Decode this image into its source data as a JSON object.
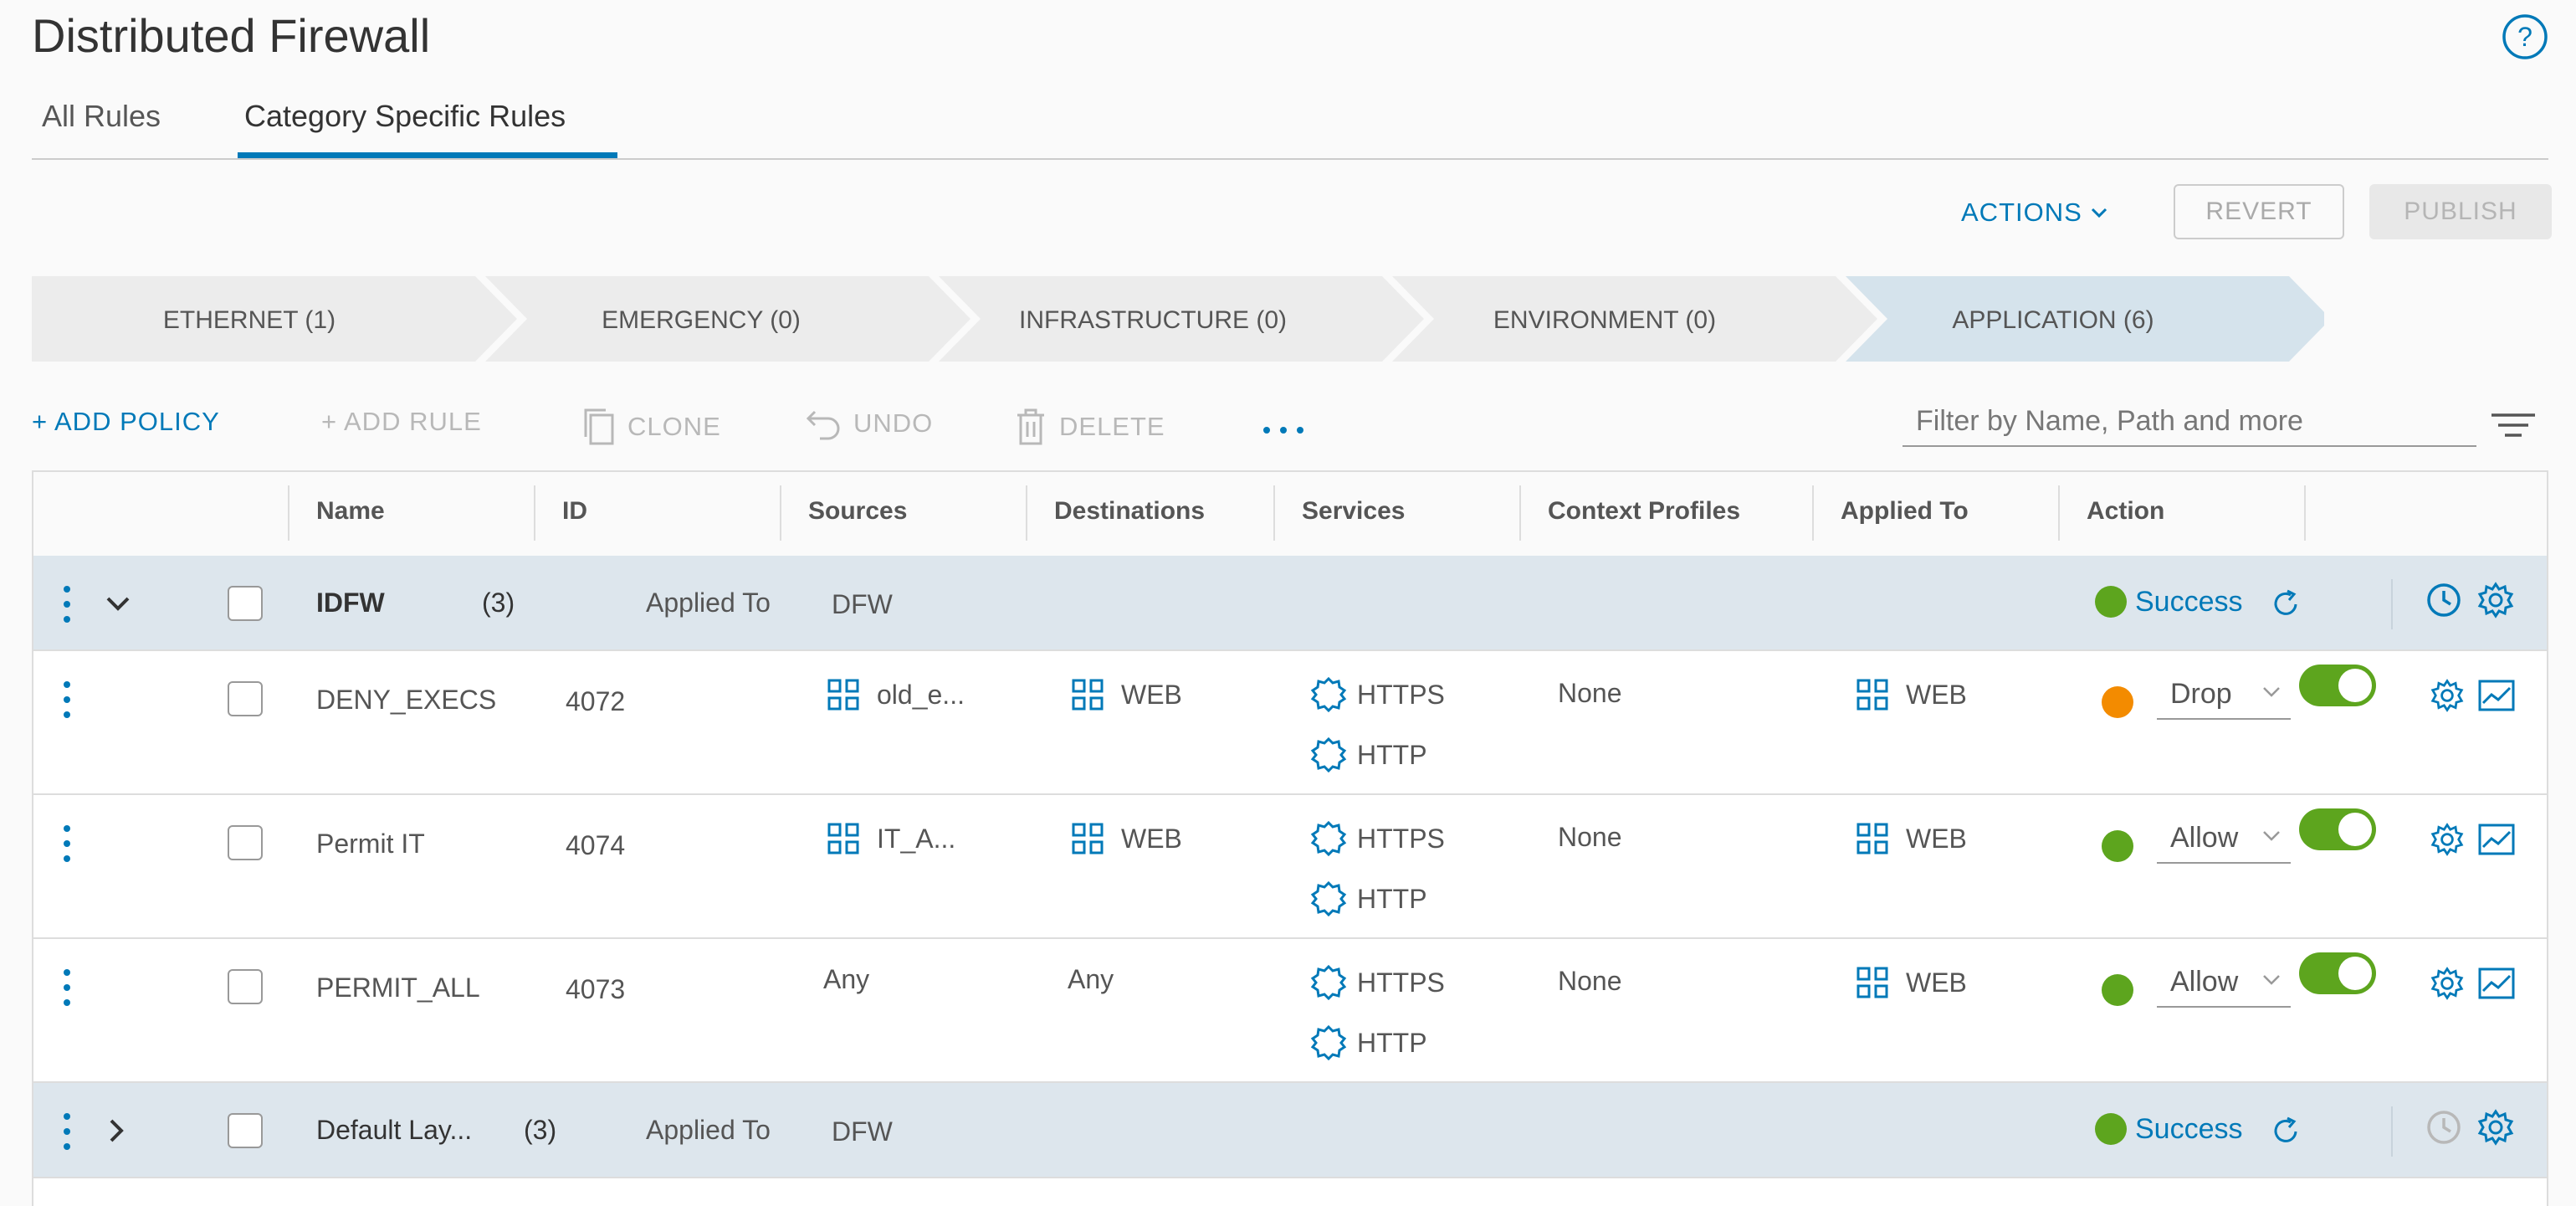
{
  "page": {
    "title": "Distributed Firewall",
    "tabs": [
      {
        "label": "All Rules"
      },
      {
        "label": "Category Specific Rules"
      }
    ]
  },
  "toolbar_top": {
    "actions_label": "ACTIONS",
    "revert_label": "REVERT",
    "publish_label": "PUBLISH"
  },
  "categories": [
    {
      "label": "ETHERNET (1)"
    },
    {
      "label": "EMERGENCY (0)"
    },
    {
      "label": "INFRASTRUCTURE (0)"
    },
    {
      "label": "ENVIRONMENT (0)"
    },
    {
      "label": "APPLICATION (6)"
    }
  ],
  "toolbar": {
    "add_policy": "+ ADD POLICY",
    "add_rule": "+ ADD RULE",
    "clone": "CLONE",
    "undo": "UNDO",
    "delete": "DELETE",
    "filter_placeholder": "Filter by Name, Path and more"
  },
  "table": {
    "columns": [
      "Name",
      "ID",
      "Sources",
      "Destinations",
      "Services",
      "Context Profiles",
      "Applied To",
      "Action"
    ],
    "policies": [
      {
        "name": "IDFW",
        "count": "(3)",
        "applied_label": "Applied To",
        "applied_value": "DFW",
        "status": "Success"
      },
      {
        "name": "Default Lay...",
        "count": "(3)",
        "applied_label": "Applied To",
        "applied_value": "DFW",
        "status": "Success"
      }
    ],
    "rules": [
      {
        "name": "DENY_EXECS",
        "id": "4072",
        "source": "old_e...",
        "destination": "WEB",
        "services": [
          "HTTPS",
          "HTTP"
        ],
        "context": "None",
        "applied_to": "WEB",
        "action": "Drop",
        "status_color": "#f38b00"
      },
      {
        "name": "Permit IT",
        "id": "4074",
        "source": "IT_A...",
        "destination": "WEB",
        "services": [
          "HTTPS",
          "HTTP"
        ],
        "context": "None",
        "applied_to": "WEB",
        "action": "Allow",
        "status_color": "#5da51e"
      },
      {
        "name": "PERMIT_ALL",
        "id": "4073",
        "source": "Any",
        "destination": "Any",
        "services": [
          "HTTPS",
          "HTTP"
        ],
        "context": "None",
        "applied_to": "WEB",
        "action": "Allow",
        "status_color": "#5da51e"
      }
    ]
  },
  "colors": {
    "accent": "#0079b8",
    "success": "#5da51e",
    "warning": "#f38b00",
    "policy_row": "#dde6ed"
  }
}
